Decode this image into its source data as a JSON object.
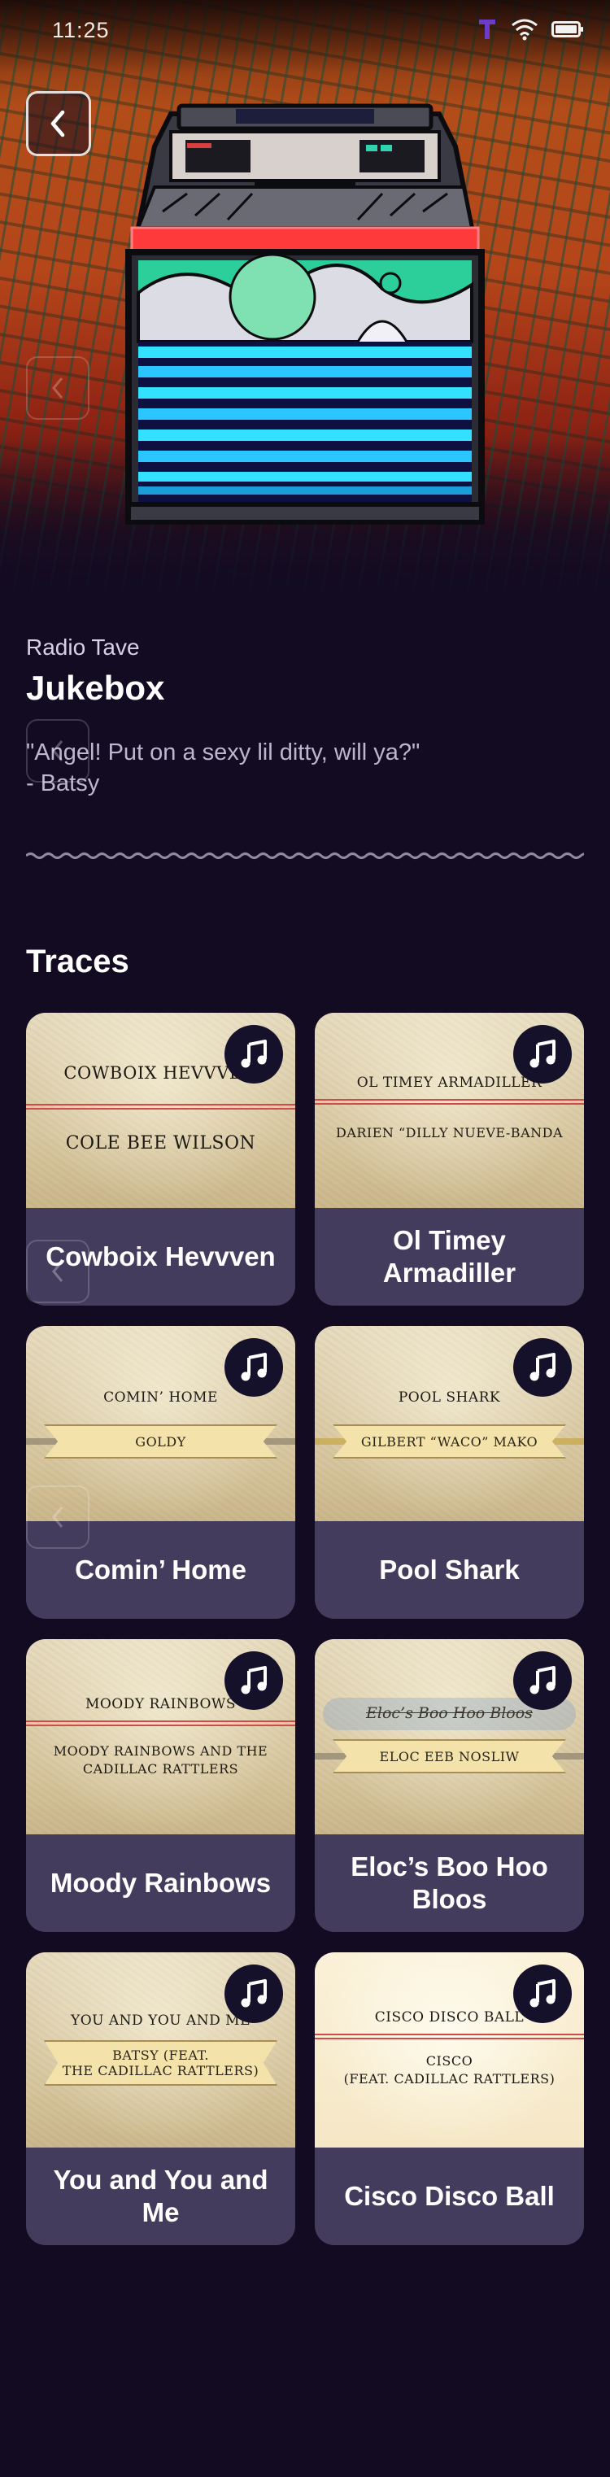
{
  "status_bar": {
    "time": "11:25"
  },
  "header": {
    "station": "Radio Tave",
    "title": "Jukebox",
    "quote_line1": "\"Angel! Put on a sexy lil ditty, will ya?\"",
    "quote_line2": "- Batsy"
  },
  "section": {
    "title": "Traces"
  },
  "colors": {
    "background": "#120b22",
    "card": "#443c5c",
    "badge": "#15112a",
    "accent_red": "#d04a4a"
  },
  "tracks": [
    {
      "title": "Cowboix Hevvven",
      "cover_top": "COWBOIX HEVVVEN",
      "cover_bottom": "COLE BEE WILSON",
      "icon": "music-note-icon"
    },
    {
      "title": "Ol Timey Armadiller",
      "cover_top": "OL TIMEY ARMADILLER",
      "cover_bottom": "DARIEN “DILLY NUEVE-BANDA",
      "icon": "music-note-icon"
    },
    {
      "title": "Comin’ Home",
      "cover_top": "COMIN’ HOME",
      "cover_bottom": "GOLDY",
      "icon": "music-note-icon"
    },
    {
      "title": "Pool Shark",
      "cover_top": "POOL SHARK",
      "cover_bottom": "GILBERT “WACO” MAKO",
      "icon": "music-note-icon"
    },
    {
      "title": "Moody Rainbows",
      "cover_top": "MOODY RAINBOWS",
      "cover_bottom_1": "MOODY RAINBOWS AND THE",
      "cover_bottom_2": "CADILLAC RATTLERS",
      "icon": "music-note-icon"
    },
    {
      "title": "Eloc’s Boo Hoo Bloos",
      "cover_top": "Eloc’s Boo Hoo Bloos",
      "cover_bottom": "ELOC EEB NOSLIW",
      "icon": "music-note-icon"
    },
    {
      "title": "You and You and Me",
      "cover_top": "YOU AND YOU AND ME",
      "cover_bottom_1": "BATSY (FEAT.",
      "cover_bottom_2": "THE CADILLAC RATTLERS)",
      "icon": "music-note-icon"
    },
    {
      "title": "Cisco Disco Ball",
      "cover_top": "CISCO DISCO BALL",
      "cover_bottom_1": "CISCO",
      "cover_bottom_2": "(FEAT. CADILLAC RATTLERS)",
      "icon": "music-note-icon"
    }
  ]
}
